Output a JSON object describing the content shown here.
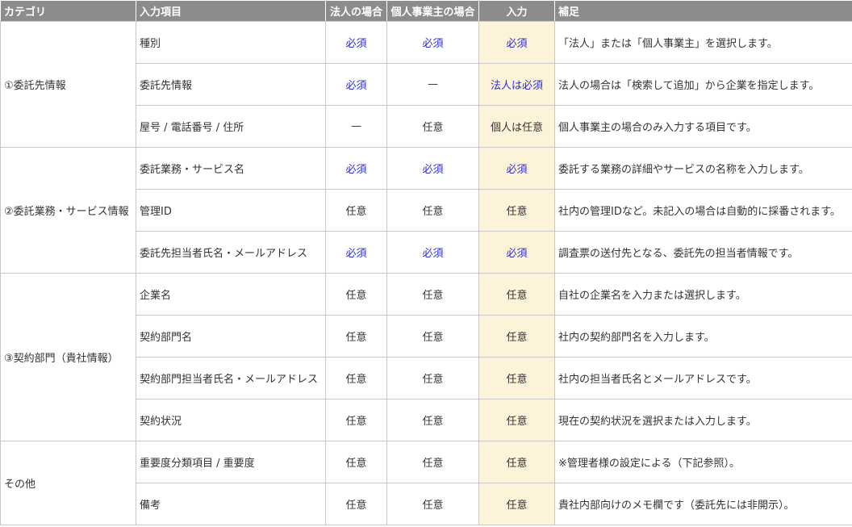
{
  "header": {
    "category": "カテゴリ",
    "field": "入力項目",
    "corporate": "法人の場合",
    "sole_proprietor": "個人事業主の場合",
    "input": "入力",
    "note": "補足"
  },
  "colors": {
    "header_bg": "#8c8c8c",
    "required_text": "#2b2bd6",
    "input_column_bg": "#fdf3d8",
    "border": "#c8c8c8"
  },
  "groups": [
    {
      "category": "①委託先情報",
      "rows": [
        {
          "field": "種別",
          "corporate": "必須",
          "corporate_req": true,
          "sole": "必須",
          "sole_req": true,
          "input": "必須",
          "input_req": true,
          "note": "「法人」または「個人事業主」を選択します。"
        },
        {
          "field": "委託先情報",
          "corporate": "必須",
          "corporate_req": true,
          "sole": "—",
          "sole_req": false,
          "input": "法人は必須",
          "input_req": true,
          "note": "法人の場合は「検索して追加」から企業を指定します。"
        },
        {
          "field": "屋号 / 電話番号 / 住所",
          "corporate": "—",
          "corporate_req": false,
          "sole": "任意",
          "sole_req": false,
          "input": "個人は任意",
          "input_req": false,
          "note": "個人事業主の場合のみ入力する項目です。"
        }
      ]
    },
    {
      "category": "②委託業務・サービス情報",
      "rows": [
        {
          "field": "委託業務・サービス名",
          "corporate": "必須",
          "corporate_req": true,
          "sole": "必須",
          "sole_req": true,
          "input": "必須",
          "input_req": true,
          "note": "委託する業務の詳細やサービスの名称を入力します。"
        },
        {
          "field": "管理ID",
          "corporate": "任意",
          "corporate_req": false,
          "sole": "任意",
          "sole_req": false,
          "input": "任意",
          "input_req": false,
          "note": "社内の管理IDなど。未記入の場合は自動的に採番されます。"
        },
        {
          "field": "委託先担当者氏名・メールアドレス",
          "corporate": "必須",
          "corporate_req": true,
          "sole": "必須",
          "sole_req": true,
          "input": "必須",
          "input_req": true,
          "note": "調査票の送付先となる、委託先の担当者情報です。"
        }
      ]
    },
    {
      "category": "③契約部門（貴社情報）",
      "rows": [
        {
          "field": "企業名",
          "corporate": "任意",
          "corporate_req": false,
          "sole": "任意",
          "sole_req": false,
          "input": "任意",
          "input_req": false,
          "note": "自社の企業名を入力または選択します。"
        },
        {
          "field": "契約部門名",
          "corporate": "任意",
          "corporate_req": false,
          "sole": "任意",
          "sole_req": false,
          "input": "任意",
          "input_req": false,
          "note": "社内の契約部門名を入力します。"
        },
        {
          "field": "契約部門担当者氏名・メールアドレス",
          "corporate": "任意",
          "corporate_req": false,
          "sole": "任意",
          "sole_req": false,
          "input": "任意",
          "input_req": false,
          "note": "社内の担当者氏名とメールアドレスです。"
        },
        {
          "field": "契約状況",
          "corporate": "任意",
          "corporate_req": false,
          "sole": "任意",
          "sole_req": false,
          "input": "任意",
          "input_req": false,
          "note": "現在の契約状況を選択または入力します。"
        }
      ]
    },
    {
      "category": "その他",
      "rows": [
        {
          "field": "重要度分類項目 / 重要度",
          "corporate": "任意",
          "corporate_req": false,
          "sole": "任意",
          "sole_req": false,
          "input": "任意",
          "input_req": false,
          "note": "※管理者様の設定による（下記参照）。"
        },
        {
          "field": "備考",
          "corporate": "任意",
          "corporate_req": false,
          "sole": "任意",
          "sole_req": false,
          "input": "任意",
          "input_req": false,
          "note": "貴社内部向けのメモ欄です（委託先には非開示）。"
        }
      ]
    }
  ]
}
